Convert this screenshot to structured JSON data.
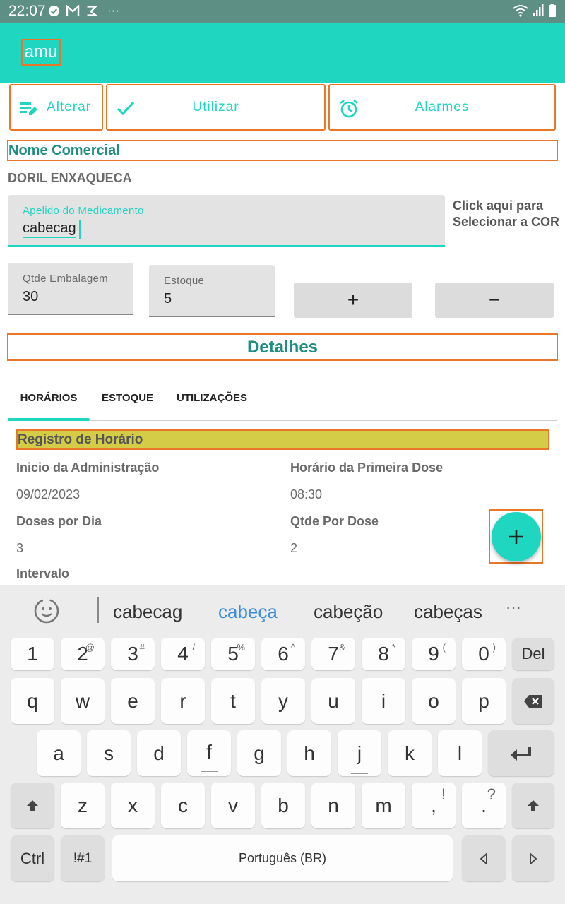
{
  "status_bar": {
    "time": "22:07"
  },
  "app_bar": {
    "title": "amu"
  },
  "actions": {
    "alterar": "Alterar",
    "utilizar": "Utilizar",
    "alarmes": "Alarmes"
  },
  "section": {
    "nome_comercial": "Nome Comercial",
    "drug_name": "DORIL ENXAQUECA"
  },
  "apelido": {
    "label": "Apelido do Medicamento",
    "value": "cabecag"
  },
  "color_pick": {
    "line1": "Click aqui para",
    "line2": "Selecionar a COR"
  },
  "qtde_embalagem": {
    "label": "Qtde Embalagem",
    "value": "30"
  },
  "estoque": {
    "label": "Estoque",
    "value": "5"
  },
  "stock_buttons": {
    "plus": "+",
    "minus": "−"
  },
  "details_title": "Detalhes",
  "tabs": [
    "HORÁRIOS",
    "ESTOQUE",
    "UTILIZAÇÕES"
  ],
  "registro": {
    "title": "Registro de Horário",
    "inicio_label": "Inicio da Administração",
    "inicio_value": "09/02/2023",
    "primeira_label": "Horário da Primeira Dose",
    "primeira_value": "08:30",
    "doses_label": "Doses por Dia",
    "doses_value": "3",
    "qtde_label": "Qtde Por Dose",
    "qtde_value": "2",
    "intervalo_label": "Intervalo"
  },
  "keyboard": {
    "suggestions": [
      "cabecag",
      "cabeça",
      "cabeção",
      "cabeças"
    ],
    "more": "···",
    "row_numbers": [
      {
        "k": "1",
        "s": "-"
      },
      {
        "k": "2",
        "s": "@"
      },
      {
        "k": "3",
        "s": "#"
      },
      {
        "k": "4",
        "s": "/"
      },
      {
        "k": "5",
        "s": "%"
      },
      {
        "k": "6",
        "s": "^"
      },
      {
        "k": "7",
        "s": "&"
      },
      {
        "k": "8",
        "s": "*"
      },
      {
        "k": "9",
        "s": "("
      },
      {
        "k": "0",
        "s": ")"
      }
    ],
    "del": "Del",
    "row1": [
      "q",
      "w",
      "e",
      "r",
      "t",
      "y",
      "u",
      "i",
      "o",
      "p"
    ],
    "row2": [
      "a",
      "s",
      "d",
      "f",
      "g",
      "h",
      "j",
      "k",
      "l"
    ],
    "row3": [
      "z",
      "x",
      "c",
      "v",
      "b",
      "n",
      "m"
    ],
    "comma": ",",
    "comma_alt": "!",
    "period": ".",
    "period_alt": "?",
    "ctrl": "Ctrl",
    "symbols": "!#1",
    "space": "Português (BR)"
  }
}
